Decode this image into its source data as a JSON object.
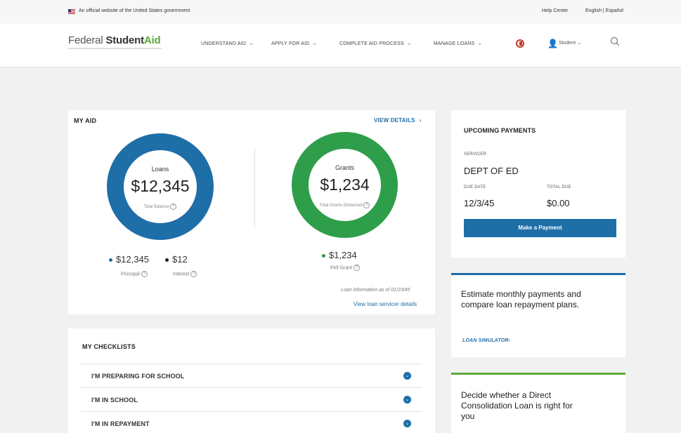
{
  "gov_banner": {
    "text": "An official website of the United States government",
    "help_center": "Help Center",
    "language": "English | Español"
  },
  "header": {
    "logo": {
      "part1": "Federal ",
      "part2": "Student",
      "part3": "Aid"
    },
    "nav": [
      {
        "label": "UNDERSTAND AID"
      },
      {
        "label": "APPLY FOR AID"
      },
      {
        "label": "COMPLETE AID PROCESS"
      },
      {
        "label": "MANAGE LOANS"
      }
    ],
    "user_label": "Student"
  },
  "my_aid": {
    "title": "MY AID",
    "view_details": "VIEW DETAILS",
    "loans": {
      "label": "Loans",
      "amount": "$12,345",
      "sub": "Total Balance"
    },
    "grants": {
      "label": "Grants",
      "amount": "$1,234",
      "sub": "Total Grants Disbursed"
    },
    "principal": {
      "amount": "$12,345",
      "label": "Principal"
    },
    "interest": {
      "amount": "$12",
      "label": "Interest"
    },
    "pell": {
      "amount": "$1,234",
      "label": "Pell Grant"
    },
    "loan_info": "Loan information as of 01/23/45",
    "servicer_link": "View loan servicer details",
    "colors": {
      "loans": "#1e6ea8",
      "grants": "#2e9e4a",
      "interest": "#222222"
    }
  },
  "checklists": {
    "title": "MY CHECKLISTS",
    "items": [
      {
        "label": "I'M PREPARING FOR SCHOOL"
      },
      {
        "label": "I'M IN SCHOOL"
      },
      {
        "label": "I'M IN REPAYMENT"
      }
    ]
  },
  "payments": {
    "title": "UPCOMING PAYMENTS",
    "servicer_label": "SERVICER",
    "servicer_value": "DEPT OF ED",
    "due_date_label": "DUE DATE",
    "due_date_value": "12/3/45",
    "total_due_label": "TOTAL DUE",
    "total_due_value": "$0.00",
    "button": "Make a Payment"
  },
  "promos": {
    "estimate_text": "Estimate monthly payments and compare loan repayment plans.",
    "estimate_link": "LOAN SIMULATOR",
    "consolidation_text": "Decide whether a Direct Consolidation Loan is right for you"
  }
}
